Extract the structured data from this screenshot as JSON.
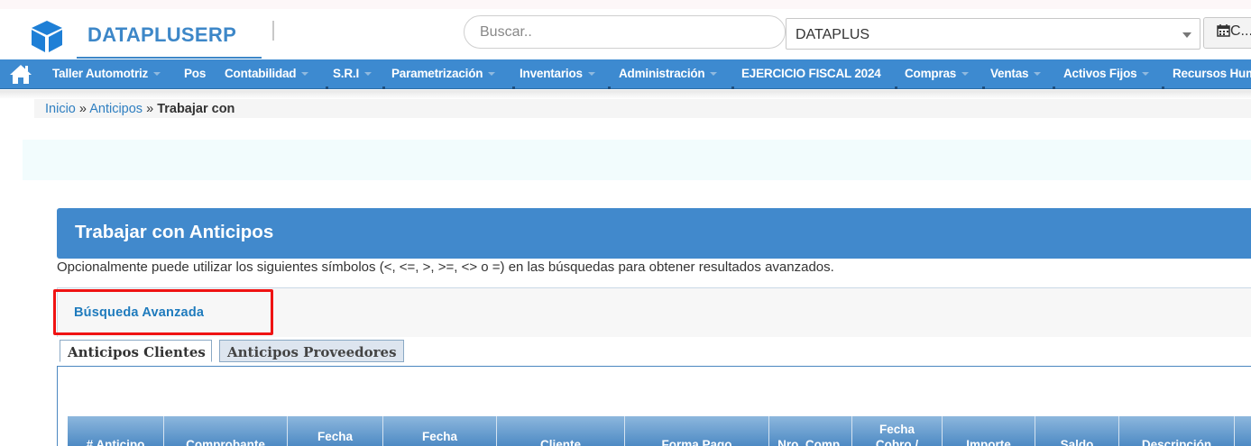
{
  "header": {
    "brand": "DATAPLUSERP",
    "search_placeholder": "Buscar..",
    "company": "DATAPLUS",
    "calendar_label": "C..."
  },
  "nav": {
    "items": [
      {
        "label": "Taller Automotriz",
        "has_menu": true
      },
      {
        "label": "Pos",
        "has_menu": false
      },
      {
        "label": "Contabilidad",
        "has_menu": true
      },
      {
        "label": "S.R.I",
        "has_menu": true
      },
      {
        "label": "Parametrización",
        "has_menu": true
      },
      {
        "label": "Inventarios",
        "has_menu": true
      },
      {
        "label": "Administración",
        "has_menu": true
      },
      {
        "label": "EJERCICIO FISCAL 2024",
        "has_menu": false
      },
      {
        "label": "Compras",
        "has_menu": true
      },
      {
        "label": "Ventas",
        "has_menu": true
      },
      {
        "label": "Activos Fijos",
        "has_menu": true
      },
      {
        "label": "Recursos Hum",
        "has_menu": false
      }
    ]
  },
  "breadcrumb": {
    "home": "Inicio",
    "sep1": "»",
    "section": "Anticipos",
    "sep2": "»",
    "current": "Trabajar con"
  },
  "panel": {
    "title": "Trabajar con Anticipos",
    "hint": "Opcionalmente puede utilizar los siguientes símbolos (<, <=, >, >=, <> o =) en las búsquedas para obtener resultados avanzados.",
    "advanced_search": "Búsqueda Avanzada"
  },
  "tabs": [
    {
      "label": "Anticipos Clientes",
      "active": true
    },
    {
      "label": "Anticipos Proveedores",
      "active": false
    }
  ],
  "table": {
    "columns": [
      [
        "# Anticipo"
      ],
      [
        "Comprobante"
      ],
      [
        "Fecha"
      ],
      [
        "Fecha"
      ],
      [
        "Cliente"
      ],
      [
        "Forma Pago"
      ],
      [
        "Nro. Comp."
      ],
      [
        "Fecha",
        "Cobro /"
      ],
      [
        "Importe"
      ],
      [
        "Saldo"
      ],
      [
        "Descripción"
      ],
      [
        ""
      ]
    ]
  },
  "colors": {
    "brand": "#3d87c8",
    "nav_bg": "#3d8ad0",
    "panel_title_bg": "#4189cc",
    "highlight": "#ef1313"
  }
}
